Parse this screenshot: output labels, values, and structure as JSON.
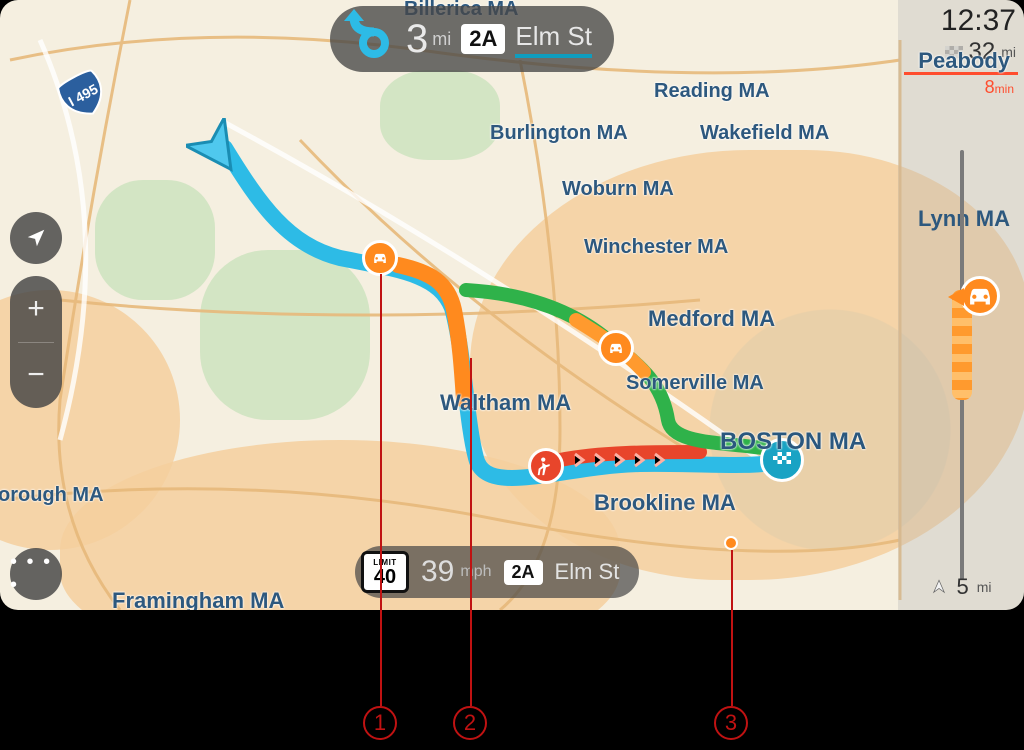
{
  "instruction": {
    "distance": "3",
    "distance_unit": "mi",
    "exit": "2A",
    "street": "Elm St"
  },
  "status": {
    "speed_limit": "40",
    "speed_limit_word": "LIMIT",
    "speed": "39",
    "speed_unit": "mph",
    "exit": "2A",
    "street": "Elm St"
  },
  "sidebar": {
    "clock": "12:37",
    "remaining_distance": "32",
    "remaining_unit": "mi",
    "delay": "8",
    "delay_unit": "min",
    "zoom": "5",
    "zoom_unit": "mi"
  },
  "cities": {
    "billerica": "Billerica MA",
    "reading": "Reading MA",
    "burlington": "Burlington MA",
    "wakefield": "Wakefield MA",
    "woburn": "Woburn MA",
    "winchester": "Winchester MA",
    "medford": "Medford MA",
    "somerville": "Somerville MA",
    "waltham": "Waltham MA",
    "boston": "BOSTON MA",
    "brookline": "Brookline MA",
    "framingham": "Framingham MA",
    "orough": "orough MA",
    "peabody": "Peabody",
    "lynn": "Lynn MA",
    "i495": "I 495"
  },
  "annotations": {
    "a1": "1",
    "a2": "2",
    "a3": "3"
  },
  "buttons": {
    "plus": "+",
    "minus": "−",
    "menu": "• • • •"
  }
}
